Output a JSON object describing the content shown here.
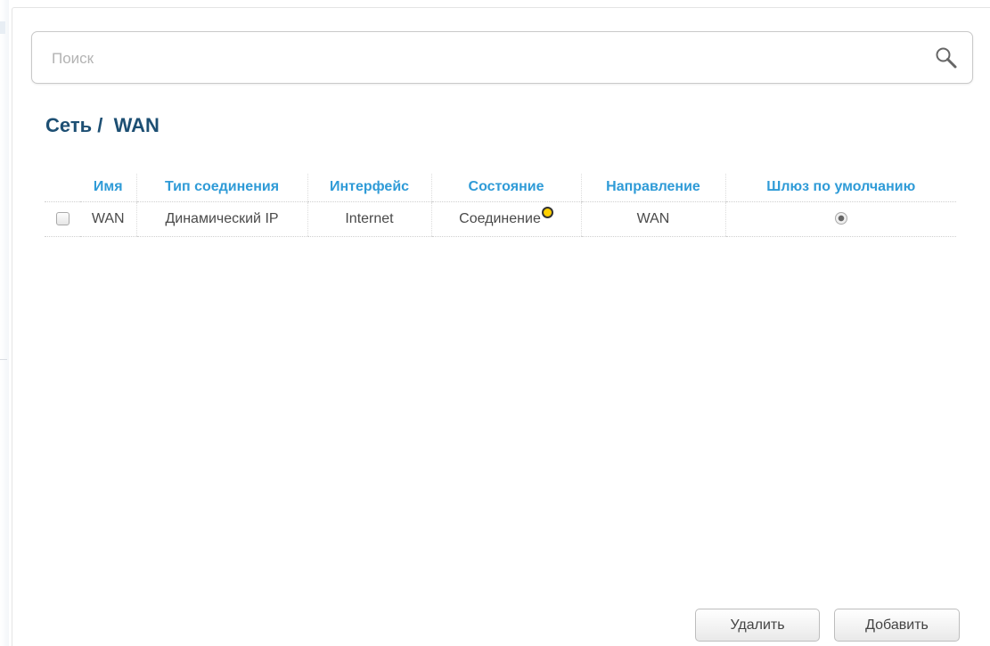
{
  "search": {
    "placeholder": "Поиск",
    "value": ""
  },
  "breadcrumb": {
    "section": "Сеть /",
    "page": "WAN"
  },
  "table": {
    "columns": [
      "Имя",
      "Тип соединения",
      "Интерфейс",
      "Состояние",
      "Направление",
      "Шлюз по умолчанию"
    ],
    "rows": [
      {
        "selected": false,
        "name": "WAN",
        "type": "Динамический IP",
        "interface": "Internet",
        "status": "Соединение",
        "status_color": "#ffd000",
        "direction": "WAN",
        "default_gateway": true
      }
    ]
  },
  "buttons": {
    "delete": "Удалить",
    "add": "Добавить"
  },
  "colors": {
    "accent": "#2f9bd7",
    "title": "#1d4f73"
  },
  "icons": {
    "search": "search-icon",
    "status": "status-dot-icon"
  }
}
